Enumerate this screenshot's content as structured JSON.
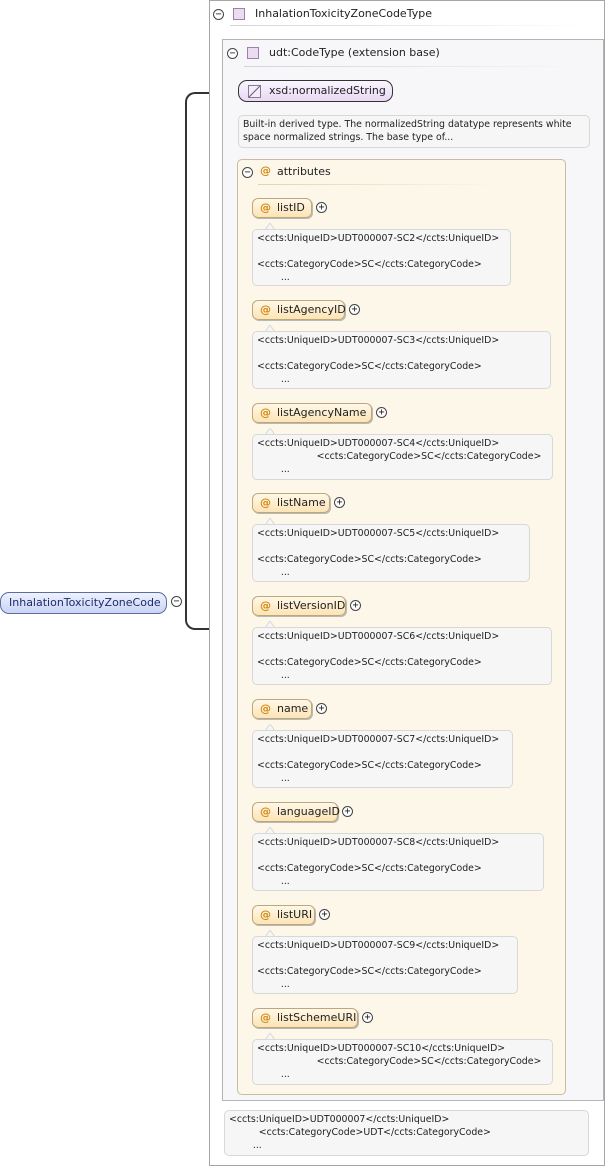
{
  "complex_type": {
    "name": "InhalationToxicityZoneCodeType"
  },
  "extension": {
    "label": "udt:CodeType (extension base)"
  },
  "base_type": {
    "label": "xsd:normalizedString",
    "doc_line1": "Built-in derived type. The normalizedString datatype represents white",
    "doc_line2": "space normalized strings. The base type of..."
  },
  "attributes_group": {
    "label": "attributes"
  },
  "attributes": [
    {
      "name": "listID",
      "doc": "<ccts:UniqueID>UDT000007-SC2</ccts:UniqueID>\n\n<ccts:CategoryCode>SC</ccts:CategoryCode>\n        ..."
    },
    {
      "name": "listAgencyID",
      "doc": "<ccts:UniqueID>UDT000007-SC3</ccts:UniqueID>\n\n<ccts:CategoryCode>SC</ccts:CategoryCode>\n        ..."
    },
    {
      "name": "listAgencyName",
      "doc": "<ccts:UniqueID>UDT000007-SC4</ccts:UniqueID>\n                    <ccts:CategoryCode>SC</ccts:CategoryCode>\n        ..."
    },
    {
      "name": "listName",
      "doc": "<ccts:UniqueID>UDT000007-SC5</ccts:UniqueID>\n\n<ccts:CategoryCode>SC</ccts:CategoryCode>\n        ..."
    },
    {
      "name": "listVersionID",
      "doc": "<ccts:UniqueID>UDT000007-SC6</ccts:UniqueID>\n\n<ccts:CategoryCode>SC</ccts:CategoryCode>\n        ..."
    },
    {
      "name": "name",
      "doc": "<ccts:UniqueID>UDT000007-SC7</ccts:UniqueID>\n\n<ccts:CategoryCode>SC</ccts:CategoryCode>\n        ..."
    },
    {
      "name": "languageID",
      "doc": "<ccts:UniqueID>UDT000007-SC8</ccts:UniqueID>\n\n<ccts:CategoryCode>SC</ccts:CategoryCode>\n        ..."
    },
    {
      "name": "listURI",
      "doc": "<ccts:UniqueID>UDT000007-SC9</ccts:UniqueID>\n\n<ccts:CategoryCode>SC</ccts:CategoryCode>\n        ..."
    },
    {
      "name": "listSchemeURI",
      "doc": "<ccts:UniqueID>UDT000007-SC10</ccts:UniqueID>\n                    <ccts:CategoryCode>SC</ccts:CategoryCode>\n        ..."
    }
  ],
  "extension_doc": "<ccts:UniqueID>UDT000007</ccts:UniqueID>\n          <ccts:CategoryCode>UDT</ccts:CategoryCode>\n        ...",
  "root_element": {
    "name": "InhalationToxicityZoneCode"
  },
  "toggle_symbols": {
    "collapse": "−",
    "expand": "+"
  }
}
